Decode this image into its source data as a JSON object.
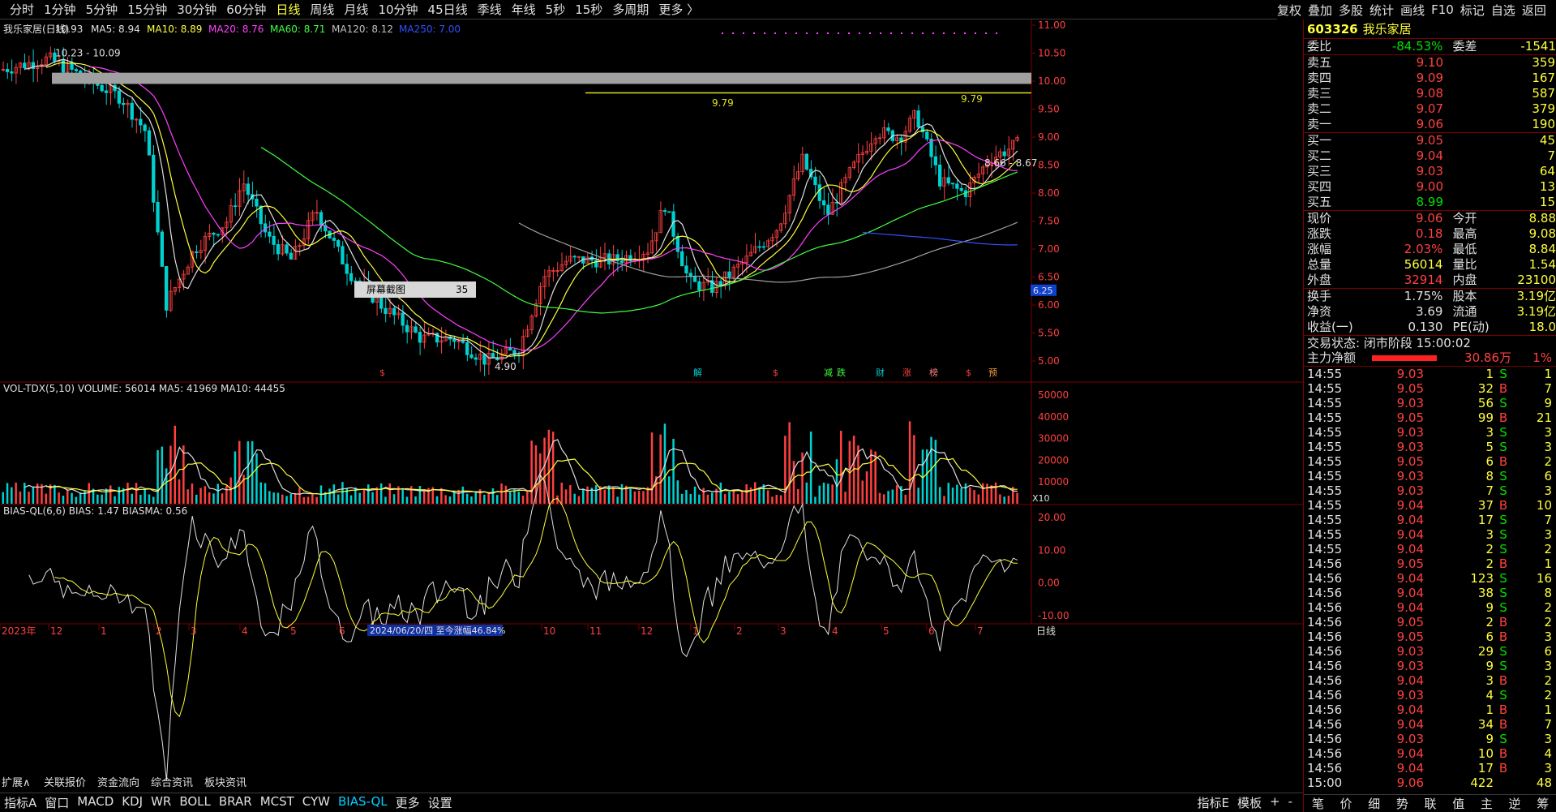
{
  "toolbar": {
    "tabs": [
      "分时",
      "1分钟",
      "5分钟",
      "15分钟",
      "30分钟",
      "60分钟",
      "日线",
      "周线",
      "月线",
      "10分钟",
      "45日线",
      "季线",
      "年线",
      "5秒",
      "15秒",
      "多周期",
      "更多 〉"
    ],
    "active_tab": "日线",
    "right_tools": [
      "复权",
      "叠加",
      "多股",
      "统计",
      "画线",
      "F10",
      "标记",
      "自选",
      "返回"
    ]
  },
  "main_chart": {
    "title": "我乐家居(日线)",
    "ma_labels": [
      {
        "text": "MA5: 8.94",
        "color": "#e0e0e0"
      },
      {
        "text": "MA10: 8.89",
        "color": "#ffff3c"
      },
      {
        "text": "MA20: 8.76",
        "color": "#ff40ff"
      },
      {
        "text": "MA60: 8.71",
        "color": "#40ff40"
      },
      {
        "text": "MA120: 8.12",
        "color": "#c0c0c0"
      },
      {
        "text": "MA250: 7.00",
        "color": "#3050ff"
      }
    ],
    "y_ticks": [
      "11.00",
      "10.50",
      "10.00",
      "9.50",
      "9.00",
      "8.50",
      "8.00",
      "7.50",
      "7.00",
      "6.50",
      "6.00",
      "5.50",
      "5.00"
    ],
    "annotations": [
      "10.93",
      "10.23 - 10.09",
      "9.79",
      "9.79",
      "8.66 - 8.67",
      "4.90",
      "6.25"
    ],
    "screenshot_tip": {
      "label": "屏幕截图",
      "value": "35"
    },
    "event_markers": [
      "$",
      "解",
      "$",
      "减",
      "跌",
      "财",
      "涨",
      "榜",
      "$",
      "预"
    ]
  },
  "volume_panel": {
    "label": "VOL-TDX(5,10) VOLUME: 56014 MA5: 41969 MA10: 44455",
    "y_ticks": [
      "50000",
      "40000",
      "30000",
      "20000",
      "10000"
    ],
    "unit": "X10"
  },
  "bias_panel": {
    "label": "BIAS-QL(6,6) BIAS: 1.47 BIASMA: 0.56",
    "y_ticks": [
      "20.00",
      "10.00",
      "0.00",
      "-10.00"
    ]
  },
  "x_axis": {
    "labels": [
      "2023年",
      "12",
      "1",
      "2",
      "3",
      "4",
      "5",
      "6",
      "10",
      "11",
      "12",
      "1",
      "2",
      "3",
      "4",
      "5",
      "6",
      "7"
    ],
    "range_label": "2024/06/20/四  至今涨幅46.84%",
    "period": "日线"
  },
  "bottom_tabs": [
    "指标A",
    "窗口",
    "MACD",
    "KDJ",
    "WR",
    "BOLL",
    "BRAR",
    "MCST",
    "CYW",
    "BIAS-QL",
    "更多",
    "设置"
  ],
  "bottom_active": "BIAS-QL",
  "bottom_right": [
    "指标E",
    "模板",
    "+",
    "-"
  ],
  "info_tabs": [
    "扩展∧",
    "关联报价",
    "资金流向",
    "综合资讯",
    "板块资讯"
  ],
  "quote": {
    "code": "603326",
    "name": "我乐家居",
    "weibi": "-84.53%",
    "weicha": "-1541",
    "sells": [
      {
        "label": "卖五",
        "price": "9.10",
        "vol": "359"
      },
      {
        "label": "卖四",
        "price": "9.09",
        "vol": "167"
      },
      {
        "label": "卖三",
        "price": "9.08",
        "vol": "587"
      },
      {
        "label": "卖二",
        "price": "9.07",
        "vol": "379"
      },
      {
        "label": "卖一",
        "price": "9.06",
        "vol": "190"
      }
    ],
    "buys": [
      {
        "label": "买一",
        "price": "9.05",
        "vol": "45"
      },
      {
        "label": "买二",
        "price": "9.04",
        "vol": "7"
      },
      {
        "label": "买三",
        "price": "9.03",
        "vol": "64"
      },
      {
        "label": "买四",
        "price": "9.00",
        "vol": "13"
      },
      {
        "label": "买五",
        "price": "8.99",
        "vol": "15"
      }
    ],
    "stats": [
      {
        "l1": "现价",
        "v1": "9.06",
        "c1": "red",
        "l2": "今开",
        "v2": "8.88",
        "c2": "red"
      },
      {
        "l1": "涨跌",
        "v1": "0.18",
        "c1": "red",
        "l2": "最高",
        "v2": "9.08",
        "c2": "red"
      },
      {
        "l1": "涨幅",
        "v1": "2.03%",
        "c1": "red",
        "l2": "最低",
        "v2": "8.84",
        "c2": "red"
      },
      {
        "l1": "总量",
        "v1": "56014",
        "c1": "yel",
        "l2": "量比",
        "v2": "1.54",
        "c2": "yel"
      },
      {
        "l1": "外盘",
        "v1": "32914",
        "c1": "red",
        "l2": "内盘",
        "v2": "23100",
        "c2": "grn"
      }
    ],
    "stats2": [
      {
        "l1": "换手",
        "v1": "1.75%",
        "l2": "股本",
        "v2": "3.19亿"
      },
      {
        "l1": "净资",
        "v1": "3.69",
        "l2": "流通",
        "v2": "3.19亿"
      },
      {
        "l1": "收益(一)",
        "v1": "0.130",
        "l2": "PE(动)",
        "v2": "18.0"
      }
    ],
    "status": "交易状态: 闭市阶段 15:00:02",
    "main_flow_label": "主力净额",
    "main_flow_value": "30.86万",
    "main_flow_pct": "1%"
  },
  "ticks": [
    {
      "t": "14:55",
      "p": "9.03",
      "v": "1",
      "bs": "S",
      "n": "1"
    },
    {
      "t": "14:55",
      "p": "9.05",
      "v": "32",
      "bs": "B",
      "n": "7"
    },
    {
      "t": "14:55",
      "p": "9.03",
      "v": "56",
      "bs": "S",
      "n": "9"
    },
    {
      "t": "14:55",
      "p": "9.05",
      "v": "99",
      "bs": "B",
      "n": "21"
    },
    {
      "t": "14:55",
      "p": "9.03",
      "v": "3",
      "bs": "S",
      "n": "3"
    },
    {
      "t": "14:55",
      "p": "9.03",
      "v": "5",
      "bs": "S",
      "n": "3"
    },
    {
      "t": "14:55",
      "p": "9.05",
      "v": "6",
      "bs": "B",
      "n": "2"
    },
    {
      "t": "14:55",
      "p": "9.03",
      "v": "8",
      "bs": "S",
      "n": "6"
    },
    {
      "t": "14:55",
      "p": "9.03",
      "v": "7",
      "bs": "S",
      "n": "3"
    },
    {
      "t": "14:55",
      "p": "9.04",
      "v": "37",
      "bs": "B",
      "n": "10"
    },
    {
      "t": "14:55",
      "p": "9.04",
      "v": "17",
      "bs": "S",
      "n": "7"
    },
    {
      "t": "14:55",
      "p": "9.04",
      "v": "3",
      "bs": "S",
      "n": "3"
    },
    {
      "t": "14:55",
      "p": "9.04",
      "v": "2",
      "bs": "S",
      "n": "2"
    },
    {
      "t": "14:56",
      "p": "9.05",
      "v": "2",
      "bs": "B",
      "n": "1"
    },
    {
      "t": "14:56",
      "p": "9.04",
      "v": "123",
      "bs": "S",
      "n": "16"
    },
    {
      "t": "14:56",
      "p": "9.04",
      "v": "38",
      "bs": "S",
      "n": "8"
    },
    {
      "t": "14:56",
      "p": "9.04",
      "v": "9",
      "bs": "S",
      "n": "2"
    },
    {
      "t": "14:56",
      "p": "9.05",
      "v": "2",
      "bs": "B",
      "n": "2"
    },
    {
      "t": "14:56",
      "p": "9.05",
      "v": "6",
      "bs": "B",
      "n": "3"
    },
    {
      "t": "14:56",
      "p": "9.03",
      "v": "29",
      "bs": "S",
      "n": "6"
    },
    {
      "t": "14:56",
      "p": "9.03",
      "v": "9",
      "bs": "S",
      "n": "3"
    },
    {
      "t": "14:56",
      "p": "9.04",
      "v": "3",
      "bs": "B",
      "n": "2"
    },
    {
      "t": "14:56",
      "p": "9.03",
      "v": "4",
      "bs": "S",
      "n": "2"
    },
    {
      "t": "14:56",
      "p": "9.04",
      "v": "1",
      "bs": "B",
      "n": "1"
    },
    {
      "t": "14:56",
      "p": "9.04",
      "v": "34",
      "bs": "B",
      "n": "7"
    },
    {
      "t": "14:56",
      "p": "9.03",
      "v": "9",
      "bs": "S",
      "n": "3"
    },
    {
      "t": "14:56",
      "p": "9.04",
      "v": "10",
      "bs": "B",
      "n": "4"
    },
    {
      "t": "14:56",
      "p": "9.04",
      "v": "17",
      "bs": "B",
      "n": "3"
    },
    {
      "t": "15:00",
      "p": "9.06",
      "v": "422",
      "bs": "",
      "n": "48"
    }
  ],
  "right_tabs": [
    "笔",
    "价",
    "细",
    "势",
    "联",
    "值",
    "主",
    "逆",
    "筹"
  ],
  "colors": {
    "up": "#ff4040",
    "down": "#00d0d0",
    "bg": "#000000",
    "axis": "#7a0000"
  }
}
